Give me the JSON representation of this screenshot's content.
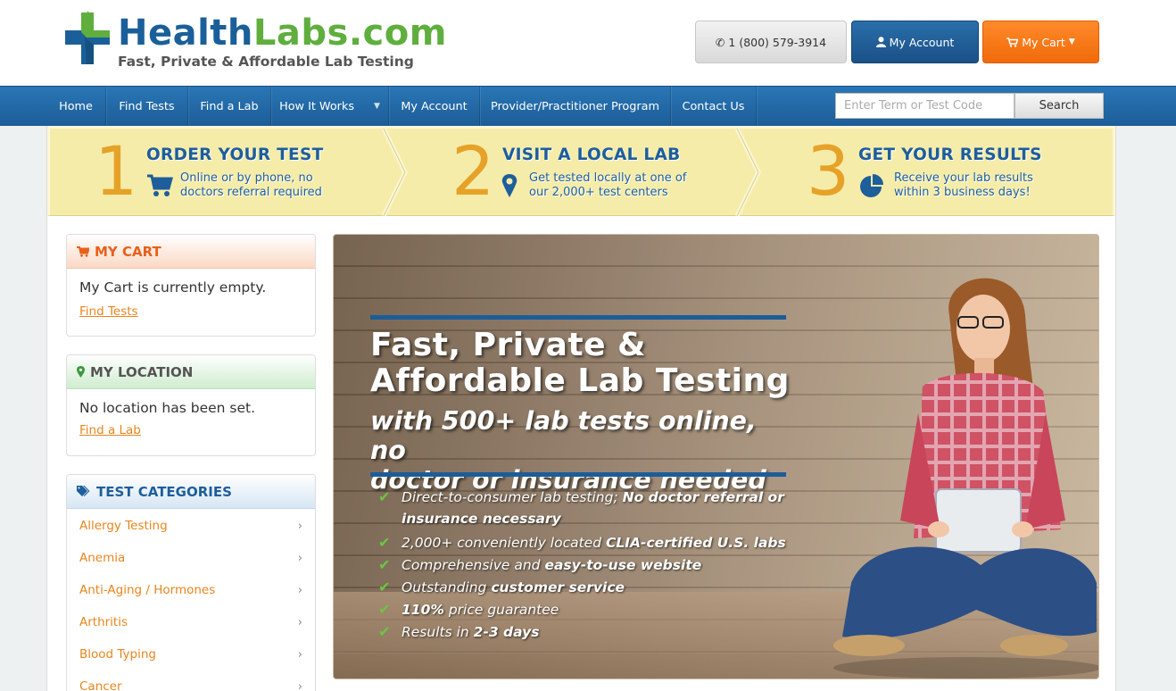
{
  "header": {
    "brand_part1": "Health",
    "brand_part2": "Labs.com",
    "tagline": "Fast, Private & Affordable Lab Testing",
    "phone_label": "1 (800) 579-3914",
    "account_label": "My Account",
    "cart_label": "My Cart",
    "logo_icon": "medical-cross-logo"
  },
  "nav": {
    "items": [
      {
        "label": "Home"
      },
      {
        "label": "Find Tests"
      },
      {
        "label": "Find a Lab"
      },
      {
        "label": "How It Works",
        "has_dropdown": true
      },
      {
        "label": "My Account"
      },
      {
        "label": "Provider/Practitioner Program"
      },
      {
        "label": "Contact Us"
      }
    ],
    "search_placeholder": "Enter Term or Test Code",
    "search_button": "Search"
  },
  "steps": [
    {
      "number": "1",
      "title": "ORDER YOUR TEST",
      "desc_line1": "Online or by phone, no",
      "desc_line2": "doctors referral required",
      "icon": "cart-icon"
    },
    {
      "number": "2",
      "title": "VISIT A LOCAL LAB",
      "desc_line1": "Get tested locally at one of",
      "desc_line2": "our 2,000+ test centers",
      "icon": "map-marker-icon"
    },
    {
      "number": "3",
      "title": "GET YOUR RESULTS",
      "desc_line1": "Receive your lab results",
      "desc_line2": "within 3 business days!",
      "icon": "pie-chart-icon"
    }
  ],
  "sidebar": {
    "cart": {
      "title": "MY CART",
      "text": "My Cart is currently empty.",
      "link": "Find Tests"
    },
    "location": {
      "title": "MY LOCATION",
      "text": "No location has been set.",
      "link": "Find a Lab"
    },
    "categories": {
      "title": "TEST CATEGORIES",
      "items": [
        "Allergy Testing",
        "Anemia",
        "Anti-Aging / Hormones",
        "Arthritis",
        "Blood Typing",
        "Cancer"
      ]
    }
  },
  "hero": {
    "headline_line1": "Fast, Private &",
    "headline_line2": "Affordable Lab Testing",
    "subhead_line1": "with 500+ lab tests online, no",
    "subhead_line2": "doctor or insurance needed",
    "features": [
      {
        "plain": "Direct-to-consumer lab testing; ",
        "bold": "No doctor referral or insurance necessary"
      },
      {
        "plain": "2,000+ conveniently located ",
        "bold": "CLIA-certified U.S. labs"
      },
      {
        "plain": "Comprehensive and ",
        "bold": "easy-to-use website"
      },
      {
        "plain": "Outstanding ",
        "bold": "customer service"
      },
      {
        "bold_first": "110%",
        "plain": " price guarantee"
      },
      {
        "plain": "Results in ",
        "bold": "2-3 days"
      }
    ]
  },
  "colors": {
    "brand_blue": "#1b5f9a",
    "brand_green": "#5fae3e",
    "nav_blue": "#1c5d98",
    "accent_orange": "#f06a0a",
    "step_number": "#e6a228",
    "steps_bg": "#f6ecaa"
  }
}
